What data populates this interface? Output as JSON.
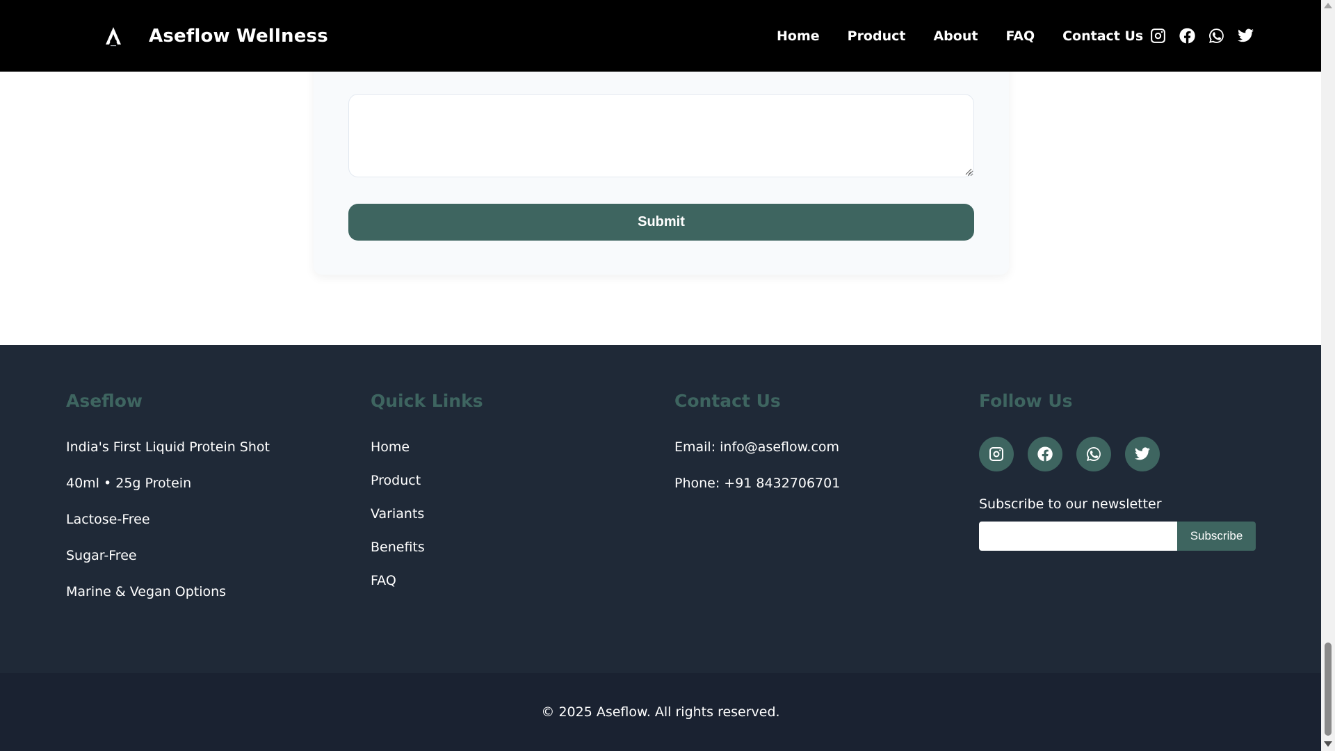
{
  "header": {
    "brand_name": "Aseflow Wellness",
    "nav": [
      "Home",
      "Product",
      "About",
      "FAQ",
      "Contact Us"
    ],
    "social_icons": [
      "instagram-icon",
      "facebook-icon",
      "whatsapp-icon",
      "twitter-icon"
    ]
  },
  "form": {
    "message_value": "",
    "submit_label": "Submit"
  },
  "footer": {
    "about": {
      "title": "Aseflow",
      "lines": [
        "India's First Liquid Protein Shot",
        "40ml • 25g Protein",
        "Lactose-Free",
        "Sugar-Free",
        "Marine & Vegan Options"
      ]
    },
    "quick_links": {
      "title": "Quick Links",
      "links": [
        "Home",
        "Product",
        "Variants",
        "Benefits",
        "FAQ"
      ]
    },
    "contact": {
      "title": "Contact Us",
      "email": "Email: info@aseflow.com",
      "phone": "Phone: +91 8432706701"
    },
    "follow": {
      "title": "Follow Us",
      "icons": [
        "instagram-icon",
        "facebook-icon",
        "whatsapp-icon",
        "twitter-icon"
      ],
      "newsletter_label": "Subscribe to our newsletter",
      "newsletter_value": "",
      "subscribe_label": "Subscribe"
    },
    "copyright": "© 2025 Aseflow. All rights reserved."
  },
  "colors": {
    "header_bg": "#000000",
    "accent": "#3e6560",
    "footer_bg": "#1f2937",
    "bottom_bar_bg": "#1a2231",
    "card_bg": "#f8fafc"
  }
}
